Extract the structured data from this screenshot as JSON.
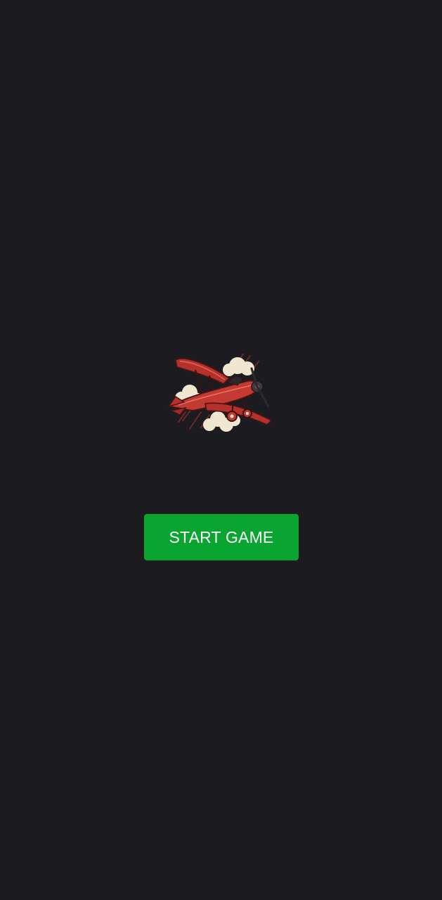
{
  "screen": {
    "background_color": "#1c1b20"
  },
  "logo": {
    "icon": "red-biplane-icon"
  },
  "start_button": {
    "label": "START GAME",
    "color": "#0aa531",
    "text_color": "#ffffff"
  }
}
